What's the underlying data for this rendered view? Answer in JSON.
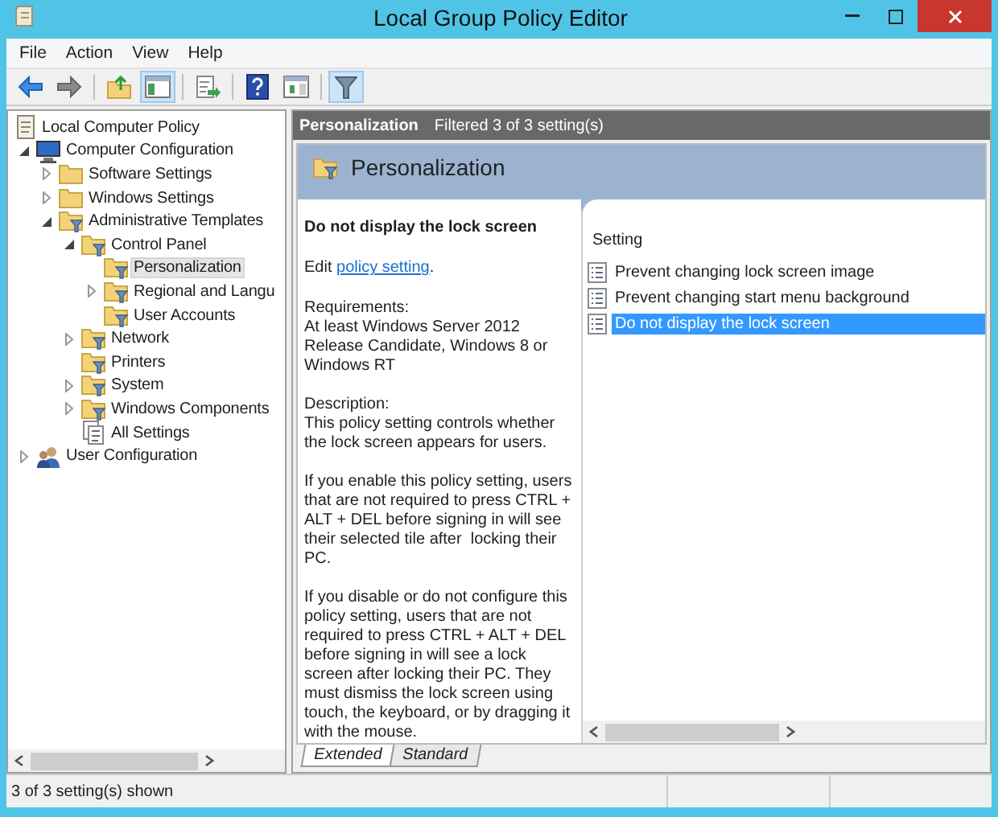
{
  "window": {
    "title": "Local Group Policy Editor"
  },
  "menu": [
    "File",
    "Action",
    "View",
    "Help"
  ],
  "toolbar": [
    {
      "kind": "back",
      "pressed": false
    },
    {
      "kind": "forward",
      "pressed": false
    },
    {
      "kind": "up",
      "pressed": false
    },
    {
      "kind": "tree",
      "pressed": true
    },
    {
      "kind": "export",
      "pressed": false
    },
    {
      "kind": "help",
      "pressed": false
    },
    {
      "kind": "pane",
      "pressed": false
    },
    {
      "kind": "filter",
      "pressed": true
    }
  ],
  "tree": [
    {
      "label": "Local Computer Policy",
      "kind": "policy",
      "selected": false,
      "children": [
        {
          "label": "Computer Configuration",
          "kind": "computer",
          "expanded": true,
          "selected": false,
          "children": [
            {
              "label": "Software Settings",
              "kind": "folder",
              "expanded": false,
              "selected": false
            },
            {
              "label": "Windows Settings",
              "kind": "folder",
              "expanded": false,
              "selected": false
            },
            {
              "label": "Administrative Templates",
              "kind": "filter-folder",
              "expanded": true,
              "selected": false,
              "children": [
                {
                  "label": "Control Panel",
                  "kind": "filter-folder",
                  "expanded": true,
                  "selected": false,
                  "children": [
                    {
                      "label": "Personalization",
                      "kind": "filter-folder",
                      "selected": true
                    },
                    {
                      "label": "Regional and Langu",
                      "kind": "filter-folder",
                      "expanded": false,
                      "selected": false
                    },
                    {
                      "label": "User Accounts",
                      "kind": "filter-folder",
                      "selected": false
                    }
                  ]
                },
                {
                  "label": "Network",
                  "kind": "filter-folder",
                  "expanded": false,
                  "selected": false
                },
                {
                  "label": "Printers",
                  "kind": "filter-folder",
                  "selected": false
                },
                {
                  "label": "System",
                  "kind": "filter-folder",
                  "expanded": false,
                  "selected": false
                },
                {
                  "label": "Windows Components",
                  "kind": "filter-folder",
                  "expanded": false,
                  "selected": false
                },
                {
                  "label": "All Settings",
                  "kind": "all-settings",
                  "selected": false
                }
              ]
            }
          ]
        },
        {
          "label": "User Configuration",
          "kind": "user",
          "expanded": false,
          "selected": false
        }
      ]
    }
  ],
  "header": {
    "title": "Personalization",
    "filter": "Filtered 3 of 3 setting(s)"
  },
  "banner": {
    "title": "Personalization"
  },
  "details": {
    "title": "Do not display the lock screen",
    "edit_prefix": "Edit",
    "edit_link": "policy setting",
    "edit_suffix": ".",
    "sections": [
      {
        "heading": "Requirements:",
        "text": "At least Windows Server 2012 Release Candidate, Windows 8 or Windows RT"
      },
      {
        "heading": "Description:",
        "text": "This policy setting controls whether the lock screen appears for users."
      },
      {
        "text": "If you enable this policy setting, users that are not required to press CTRL + ALT + DEL before signing in will see their selected tile after  locking their PC."
      },
      {
        "text": "If you disable or do not configure this policy setting, users that are not required to press CTRL + ALT + DEL before signing in will see a lock screen after locking their PC. They must dismiss the lock screen using touch, the keyboard, or by dragging it with the mouse."
      }
    ]
  },
  "settings": {
    "column": "Setting",
    "rows": [
      {
        "name": "Prevent changing lock screen image",
        "selected": false
      },
      {
        "name": "Prevent changing start menu background",
        "selected": false
      },
      {
        "name": "Do not display the lock screen",
        "selected": true
      }
    ]
  },
  "tabs": [
    {
      "label": "Extended",
      "selected": true
    },
    {
      "label": "Standard",
      "selected": false
    }
  ],
  "status_bar": "3 of 3 setting(s) shown"
}
